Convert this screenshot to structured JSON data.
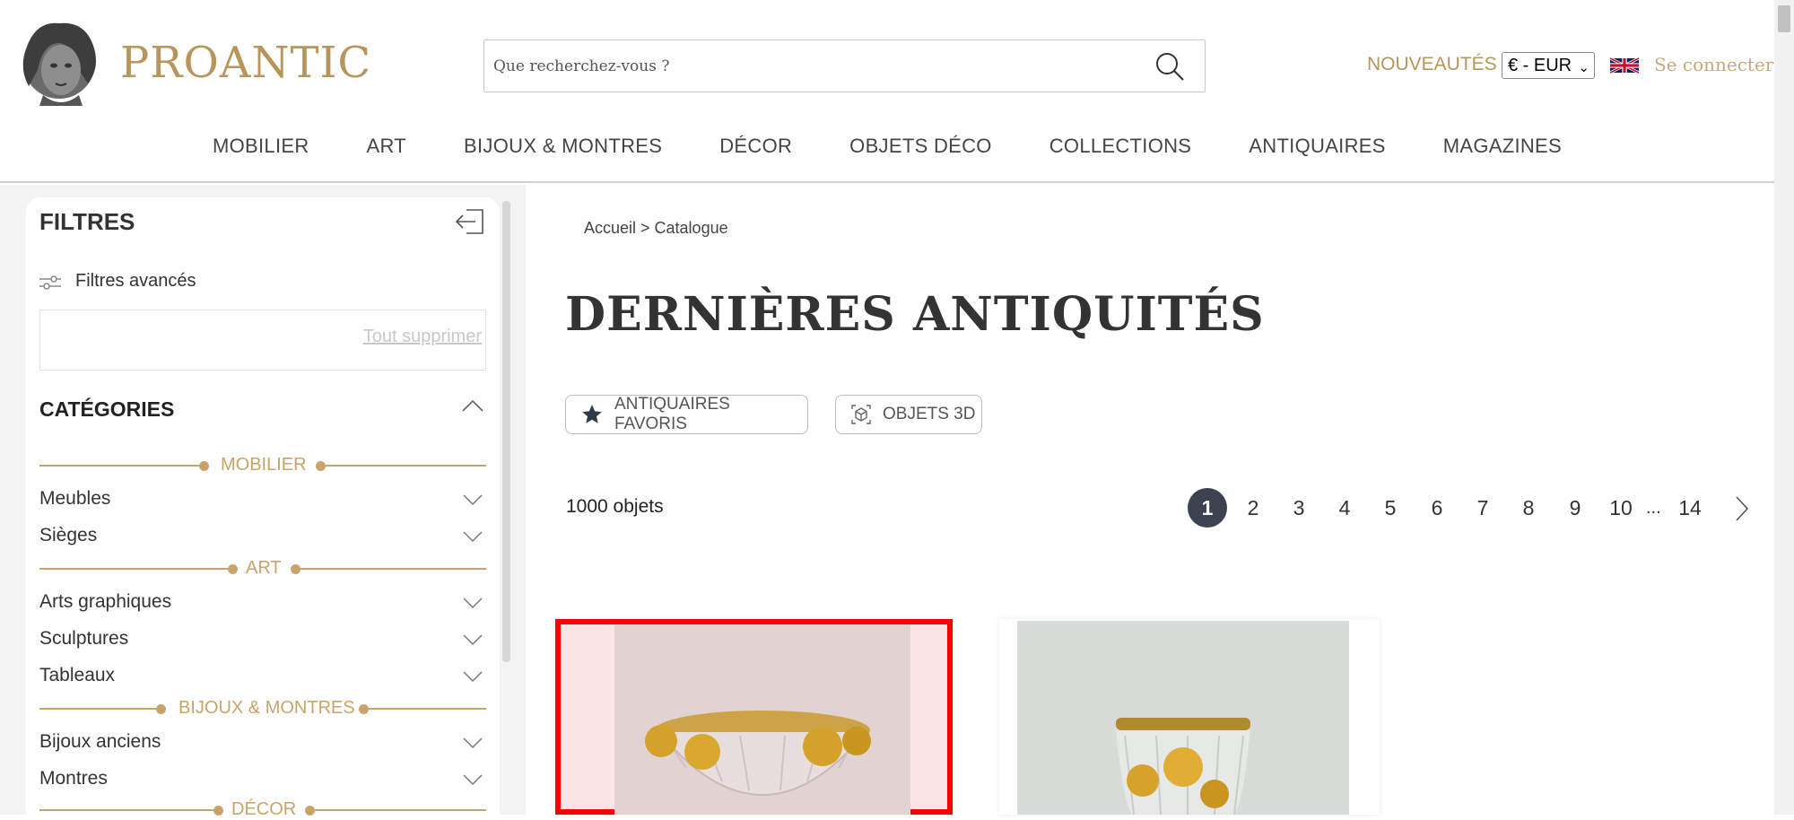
{
  "header": {
    "logo_text": "PROANTIC",
    "search_placeholder": "Que recherchez-vous ?",
    "nouveautes": "NOUVEAUTÉS",
    "currency": "€ - EUR",
    "login": "Se connecter"
  },
  "nav": [
    "MOBILIER",
    "ART",
    "BIJOUX & MONTRES",
    "DÉCOR",
    "OBJETS DÉCO",
    "COLLECTIONS",
    "ANTIQUAIRES",
    "MAGAZINES"
  ],
  "sidebar": {
    "title": "FILTRES",
    "advanced_filters": "Filtres avancés",
    "clear_all": "Tout supprimer",
    "categories_title": "CATÉGORIES",
    "groups": [
      {
        "label": "MOBILIER",
        "items": [
          "Meubles",
          "Sièges"
        ]
      },
      {
        "label": "ART",
        "items": [
          "Arts graphiques",
          "Sculptures",
          "Tableaux"
        ]
      },
      {
        "label": "BIJOUX & MONTRES",
        "items": [
          "Bijoux anciens",
          "Montres"
        ]
      },
      {
        "label": "DÉCOR",
        "items": []
      }
    ]
  },
  "main": {
    "breadcrumb": "Accueil > Catalogue",
    "title": "DERNIÈRES ANTIQUITÉS",
    "pills": [
      "ANTIQUAIRES FAVORIS",
      "OBJETS 3D"
    ],
    "count": "1000 objets",
    "pagination": {
      "current": "1",
      "pages": [
        "1",
        "2",
        "3",
        "4",
        "5",
        "6",
        "7",
        "8",
        "9",
        "10"
      ],
      "ellipsis": "...",
      "last": "14"
    }
  },
  "colors": {
    "brand_gold": "#b8955a",
    "active_page": "#3b4350",
    "highlight": "#ff0000"
  }
}
